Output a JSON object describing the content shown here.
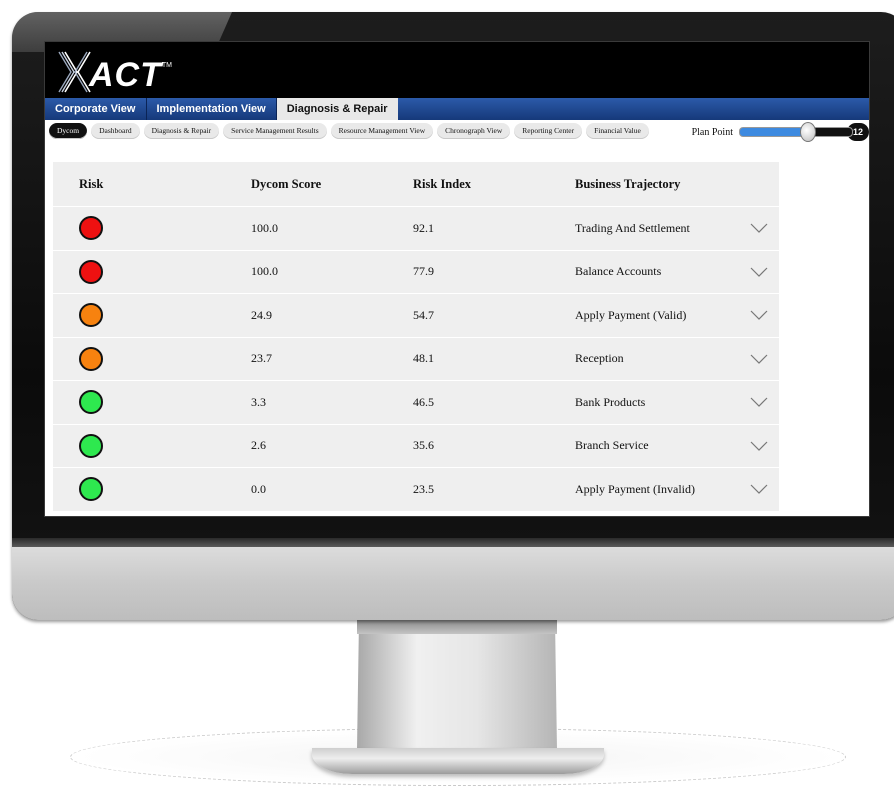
{
  "app": {
    "logo_text": "ACT",
    "logo_tm": "TM"
  },
  "nav": {
    "tabs": [
      {
        "label": "Corporate View",
        "active": false
      },
      {
        "label": "Implementation View",
        "active": false
      },
      {
        "label": "Diagnosis & Repair",
        "active": true
      }
    ]
  },
  "subnav": {
    "tabs": [
      {
        "label": "Dycom",
        "active": true
      },
      {
        "label": "Dashboard",
        "active": false
      },
      {
        "label": "Diagnosis & Repair",
        "active": false
      },
      {
        "label": "Service Management Results",
        "active": false
      },
      {
        "label": "Resource Management View",
        "active": false
      },
      {
        "label": "Chronograph View",
        "active": false
      },
      {
        "label": "Reporting Center",
        "active": false
      },
      {
        "label": "Financial Value",
        "active": false
      }
    ]
  },
  "plan_point": {
    "label": "Plan Point",
    "value": "12",
    "slider_fraction": 0.6
  },
  "table": {
    "headers": {
      "risk": "Risk",
      "score": "Dycom Score",
      "index": "Risk Index",
      "trajectory": "Business Trajectory"
    },
    "rows": [
      {
        "risk_color": "#ee1111",
        "score": "100.0",
        "index": "92.1",
        "trajectory": "Trading And Settlement"
      },
      {
        "risk_color": "#ee1111",
        "score": "100.0",
        "index": "77.9",
        "trajectory": "Balance Accounts"
      },
      {
        "risk_color": "#f7820f",
        "score": "24.9",
        "index": "54.7",
        "trajectory": "Apply Payment (Valid)"
      },
      {
        "risk_color": "#f7820f",
        "score": "23.7",
        "index": "48.1",
        "trajectory": "Reception"
      },
      {
        "risk_color": "#2ee84f",
        "score": "3.3",
        "index": "46.5",
        "trajectory": "Bank Products"
      },
      {
        "risk_color": "#2ee84f",
        "score": "2.6",
        "index": "35.6",
        "trajectory": "Branch Service"
      },
      {
        "risk_color": "#2ee84f",
        "score": "0.0",
        "index": "23.5",
        "trajectory": "Apply Payment (Invalid)"
      }
    ]
  }
}
